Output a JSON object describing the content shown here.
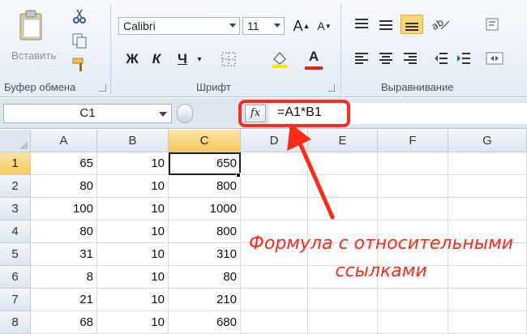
{
  "ribbon": {
    "clipboard": {
      "paste_label": "Вставить",
      "group_label": "Буфер обмена"
    },
    "font": {
      "font_name": "Calibri",
      "font_size": "11",
      "bold": "Ж",
      "italic": "К",
      "underline": "Ч",
      "grow_font": "A",
      "shrink_font": "A",
      "font_color_letter": "A",
      "group_label": "Шрифт"
    },
    "alignment": {
      "group_label": "Выравнивание"
    }
  },
  "formula_bar": {
    "name_box": "C1",
    "fx_label": "fx",
    "formula": "=A1*B1"
  },
  "sheet": {
    "columns": [
      "A",
      "B",
      "C",
      "D",
      "E",
      "F",
      "G"
    ],
    "rows": [
      {
        "num": "1",
        "a": "65",
        "b": "10",
        "c": "650"
      },
      {
        "num": "2",
        "a": "80",
        "b": "10",
        "c": "800"
      },
      {
        "num": "3",
        "a": "100",
        "b": "10",
        "c": "1000"
      },
      {
        "num": "4",
        "a": "80",
        "b": "10",
        "c": "800"
      },
      {
        "num": "5",
        "a": "31",
        "b": "10",
        "c": "310"
      },
      {
        "num": "6",
        "a": "8",
        "b": "10",
        "c": "80"
      },
      {
        "num": "7",
        "a": "21",
        "b": "10",
        "c": "210"
      },
      {
        "num": "8",
        "a": "68",
        "b": "10",
        "c": "680"
      }
    ]
  },
  "annotation": {
    "line1": "Формула с относительными",
    "line2": "ссылками",
    "color": "#ff2a1a"
  },
  "colors": {
    "selection": "#f6c95e",
    "highlight": "#ff2a1a",
    "active_button": "#fbd97a"
  }
}
